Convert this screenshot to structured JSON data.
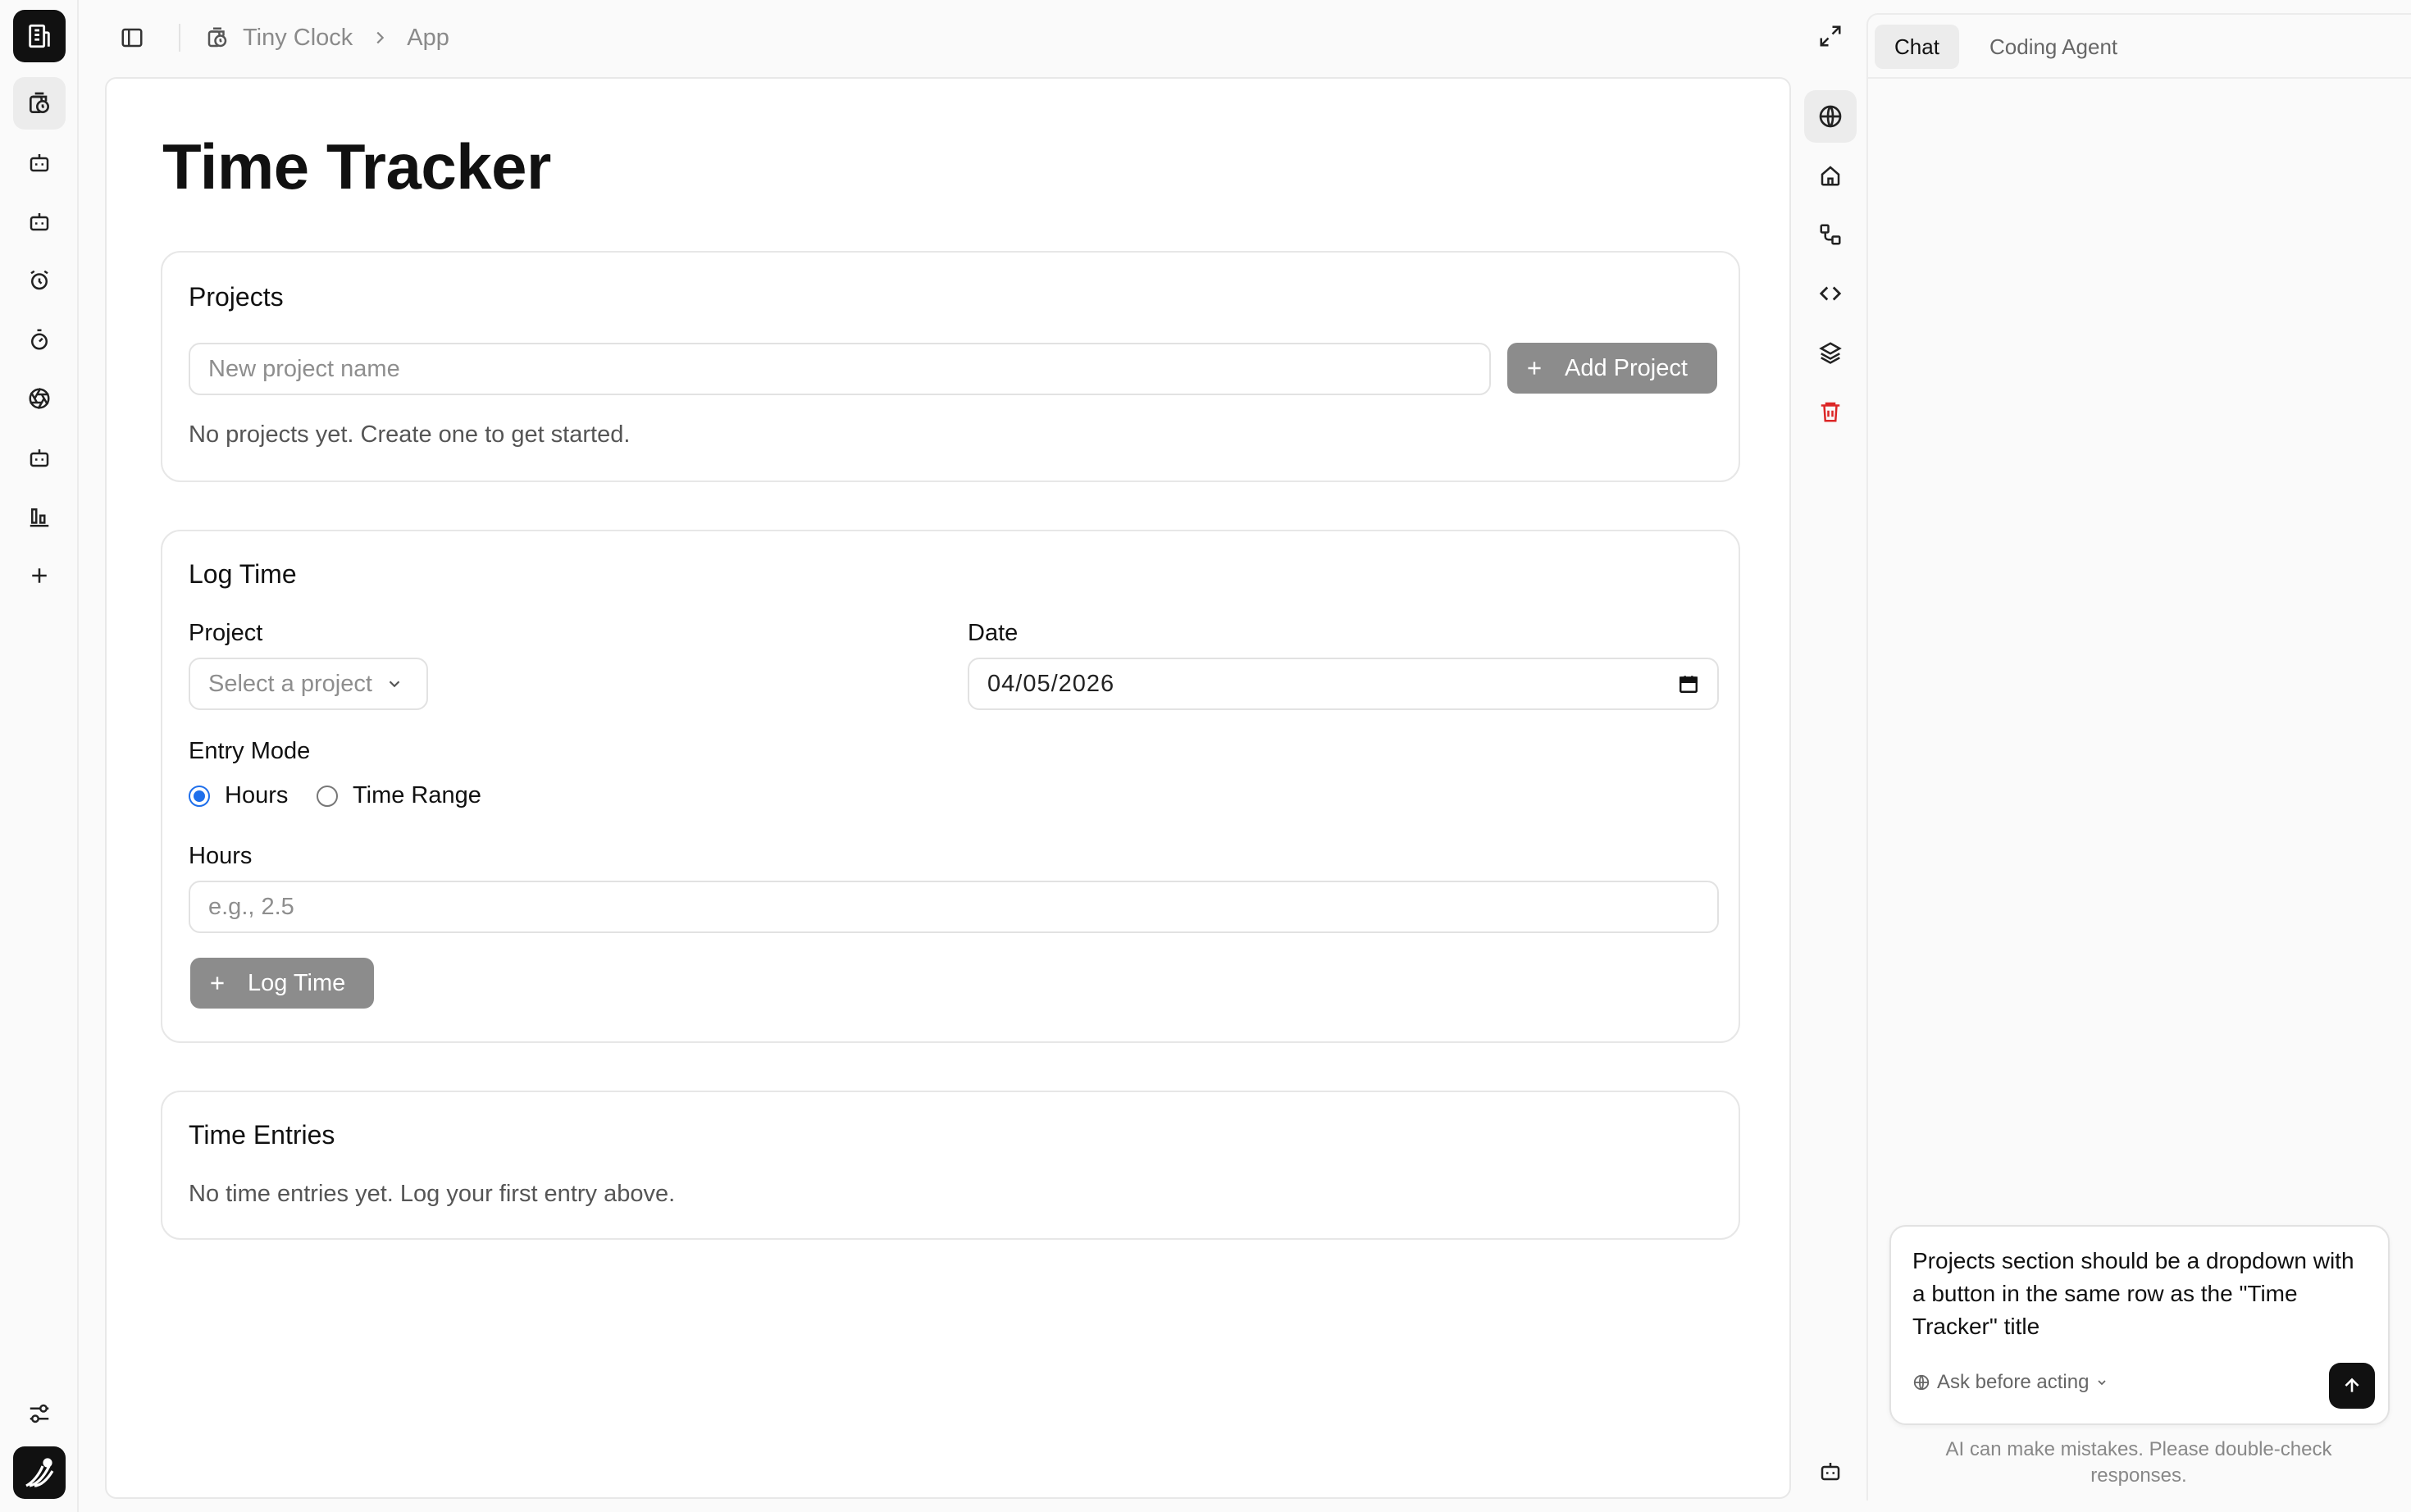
{
  "breadcrumb": {
    "project": "Tiny Clock",
    "page": "App"
  },
  "app": {
    "title": "Time Tracker",
    "projects": {
      "title": "Projects",
      "input_placeholder": "New project name",
      "add_label": "Add Project",
      "empty": "No projects yet. Create one to get started."
    },
    "log_time": {
      "title": "Log Time",
      "project_label": "Project",
      "project_placeholder": "Select a project",
      "date_label": "Date",
      "date_value": "04/05/2026",
      "entry_mode_label": "Entry Mode",
      "mode_hours": "Hours",
      "mode_range": "Time Range",
      "selected_mode": "Hours",
      "hours_label": "Hours",
      "hours_placeholder": "e.g., 2.5",
      "submit_label": "Log Time"
    },
    "entries": {
      "title": "Time Entries",
      "empty": "No time entries yet. Log your first entry above."
    }
  },
  "chat": {
    "tabs": [
      {
        "label": "Chat",
        "active": true
      },
      {
        "label": "Coding Agent",
        "active": false
      }
    ],
    "draft": "Projects section should be a dropdown with a button in the same row as the \"Time Tracker\" title",
    "mode": "Ask before acting",
    "disclaimer": "AI can make mistakes. Please double-check responses."
  },
  "left_rail_icons": [
    "building-icon",
    "clock-app-icon",
    "bot-icon",
    "bot-icon",
    "alarm-icon",
    "timer-icon",
    "aperture-icon",
    "bot-icon",
    "chart-icon",
    "plus-icon",
    "settings-sliders-icon",
    "avatar"
  ],
  "tool_icons": [
    "globe-icon",
    "home-icon",
    "workflow-icon",
    "code-icon",
    "layers-icon",
    "trash-icon",
    "bot-icon"
  ],
  "colors": {
    "accent": "#1f6feb",
    "danger": "#dc2626",
    "button_disabled": "#8c8c8c"
  }
}
